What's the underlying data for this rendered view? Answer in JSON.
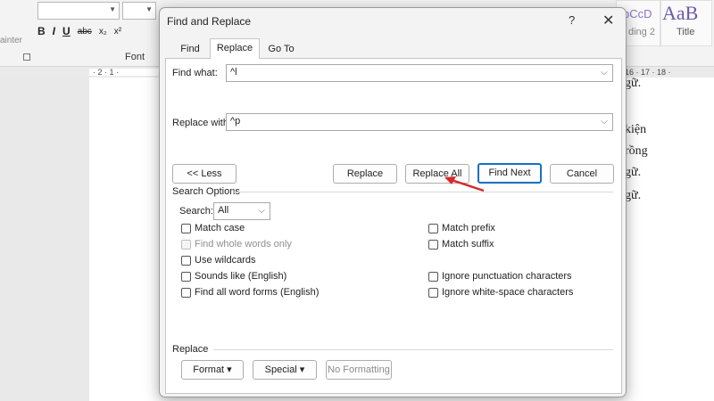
{
  "ribbon": {
    "painter_label": "ainter",
    "font_group_label": "Font",
    "format_buttons": [
      "B",
      "I",
      "U",
      "abc",
      "x₂",
      "x²"
    ],
    "styles": [
      {
        "sample": "bCcD",
        "name": "ding 2"
      },
      {
        "sample": "AaB",
        "name": "Title"
      }
    ],
    "ruler_left": "· 2 · 1 ·",
    "ruler_right": "16 · 17 · 18 ·"
  },
  "document": {
    "lines": [
      "gữ.",
      "kiện",
      "rồng",
      "gữ.",
      "gữ."
    ]
  },
  "dialog": {
    "title": "Find and Replace",
    "help": "?",
    "close": "✕",
    "tabs": [
      {
        "label": "Find",
        "active": false
      },
      {
        "label": "Replace",
        "active": true
      },
      {
        "label": "Go To",
        "active": false
      }
    ],
    "find_what_label": "Find what:",
    "find_what_value": "^l",
    "replace_with_label": "Replace with:",
    "replace_with_value": "^p",
    "buttons": {
      "less": "<< Less",
      "replace": "Replace",
      "replace_all": "Replace All",
      "find_next": "Find Next",
      "cancel": "Cancel"
    },
    "search_options_label": "Search Options",
    "search_label": "Search:",
    "search_value": "All",
    "left_options": [
      {
        "label": "Match case",
        "checked": false,
        "disabled": false
      },
      {
        "label": "Find whole words only",
        "checked": false,
        "disabled": true
      },
      {
        "label": "Use wildcards",
        "checked": false,
        "disabled": false
      },
      {
        "label": "Sounds like (English)",
        "checked": false,
        "disabled": false
      },
      {
        "label": "Find all word forms (English)",
        "checked": false,
        "disabled": false
      }
    ],
    "right_options": [
      {
        "label": "Match prefix",
        "checked": false,
        "disabled": false
      },
      {
        "label": "Match suffix",
        "checked": false,
        "disabled": false
      },
      {
        "label": "Ignore punctuation characters",
        "checked": false,
        "disabled": false
      },
      {
        "label": "Ignore white-space characters",
        "checked": false,
        "disabled": false
      }
    ],
    "replace_section_label": "Replace",
    "format_button": "Format ▾",
    "special_button": "Special ▾",
    "no_formatting_button": "No Formatting"
  },
  "annotation": {
    "color": "#d42a2a",
    "points_to": "replace_all"
  }
}
